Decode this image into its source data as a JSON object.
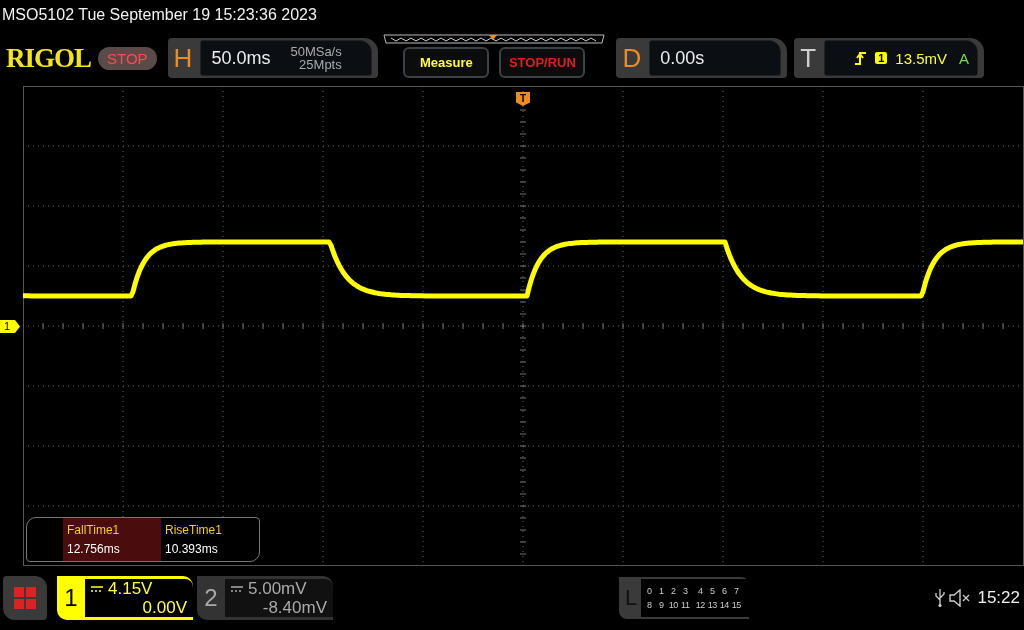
{
  "title_bar": {
    "text": "MSO5102  Tue September 19 15:23:36 2023"
  },
  "header": {
    "logo": "RIGOL",
    "run_status": "STOP",
    "horizontal": {
      "label": "H",
      "timebase": "50.0ms",
      "sample_rate": "50MSa/s",
      "memory_depth": "25Mpts"
    },
    "buttons": [
      {
        "label": "Measure",
        "kind": "measure"
      },
      {
        "label": "STOP/RUN",
        "kind": "run"
      }
    ],
    "delay": {
      "label": "D",
      "value": "0.00s"
    },
    "trigger": {
      "label": "T",
      "source": "1",
      "level": "13.5mV",
      "mode": "A"
    }
  },
  "display": {
    "trigger_position_marker": "T",
    "channel_marker": "1",
    "measurements": [
      {
        "name": "FallTime1",
        "value": "12.756ms",
        "selected": true
      },
      {
        "name": "RiseTime1",
        "value": "10.393ms",
        "selected": false
      }
    ]
  },
  "bottom_bar": {
    "channels": [
      {
        "number": "1",
        "scale": "4.15V",
        "offset": "0.00V",
        "enabled": true
      },
      {
        "number": "2",
        "scale": "5.00mV",
        "offset": "-8.40mV",
        "enabled": false
      }
    ],
    "logic": {
      "label": "L",
      "rows": [
        [
          "0",
          "1",
          "2",
          "3",
          "4",
          "5",
          "6",
          "7"
        ],
        [
          "8",
          "9",
          "10",
          "11",
          "12",
          "13",
          "14",
          "15"
        ]
      ]
    },
    "time": "15:22"
  }
}
